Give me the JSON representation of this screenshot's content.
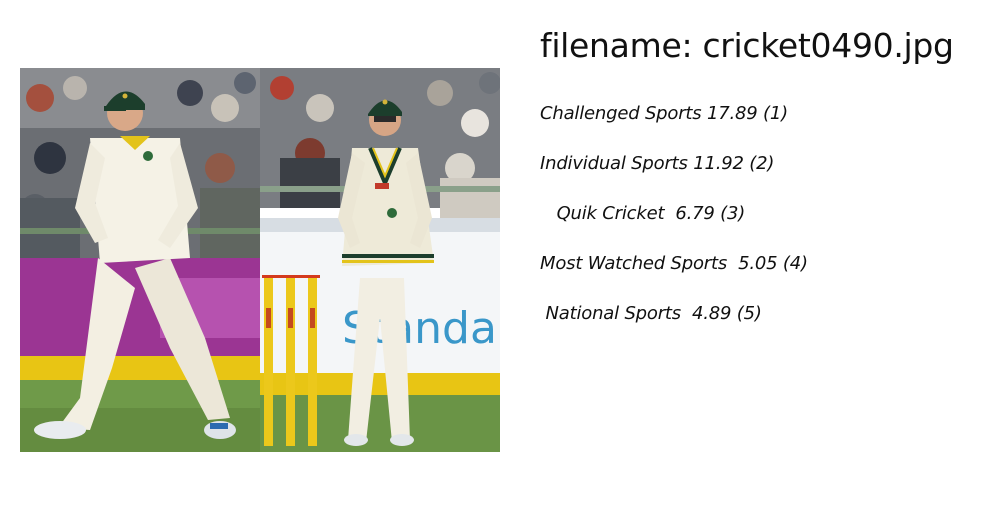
{
  "filename_label": "filename: cricket0490.jpg",
  "predictions": [
    {
      "text": "Challenged Sports 17.89 (1)"
    },
    {
      "text": "Individual Sports 11.92 (2)"
    },
    {
      "text": "   Quik Cricket  6.79 (3)"
    },
    {
      "text": "Most Watched Sports  5.05 (4)"
    },
    {
      "text": " National Sports  4.89 (5)"
    }
  ],
  "image": {
    "description_icon": "photo",
    "banner_text": "Standa"
  }
}
